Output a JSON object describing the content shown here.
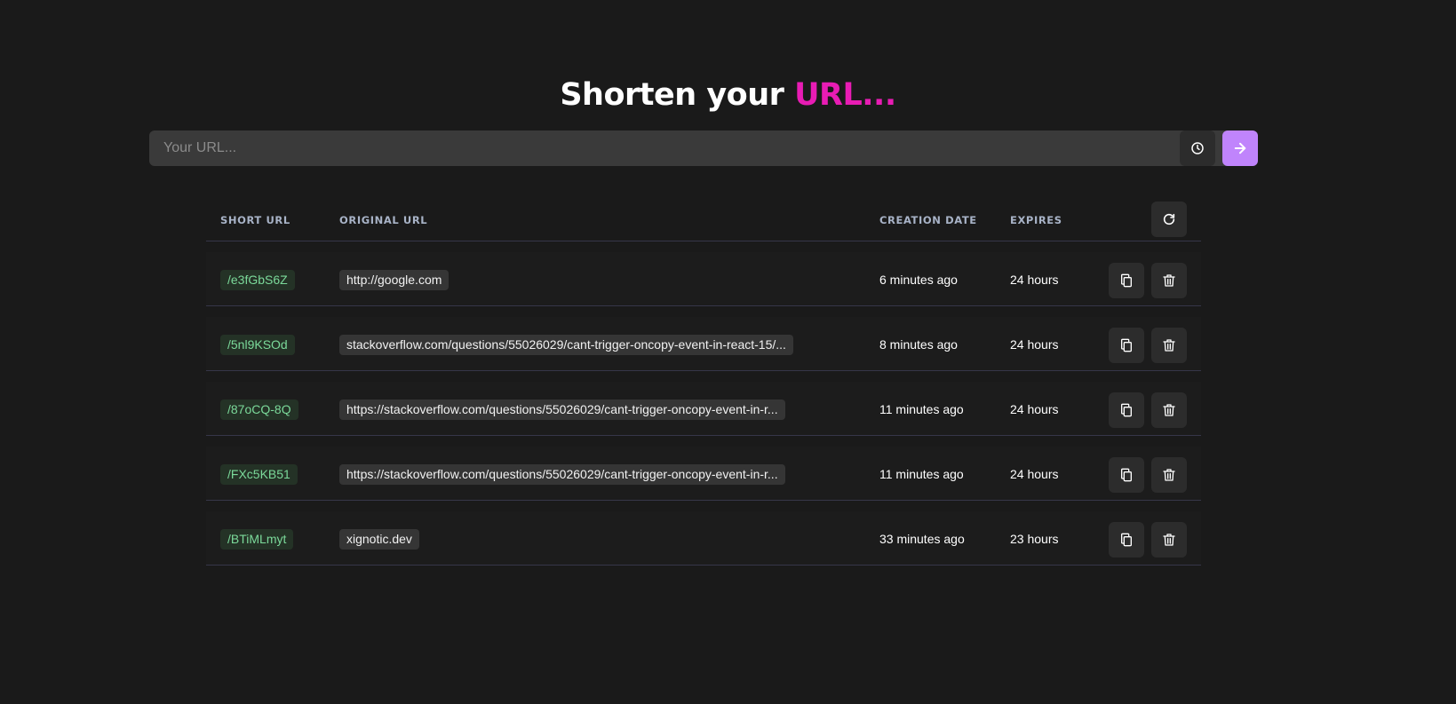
{
  "header": {
    "title_main": "Shorten your ",
    "title_accent": "URL..."
  },
  "url_input": {
    "placeholder": "Your URL...",
    "value": ""
  },
  "icons": {
    "history": "clock-icon",
    "submit": "arrow-right-icon",
    "refresh": "refresh-icon",
    "copy": "copy-icon",
    "delete": "trash-icon"
  },
  "colors": {
    "background": "#1a1a1a",
    "accent": "#e81cb4",
    "submit_button": "#c084fc",
    "short_url_text": "#7bd99a",
    "short_url_bg": "#243226"
  },
  "table": {
    "columns": [
      "SHORT URL",
      "ORIGINAL URL",
      "CREATION DATE",
      "EXPIRES"
    ],
    "rows": [
      {
        "short": "/e3fGbS6Z",
        "original": "http://google.com",
        "created": "6 minutes ago",
        "expires": "24 hours"
      },
      {
        "short": "/5nl9KSOd",
        "original": "stackoverflow.com/questions/55026029/cant-trigger-oncopy-event-in-react-15/...",
        "created": "8 minutes ago",
        "expires": "24 hours"
      },
      {
        "short": "/87oCQ-8Q",
        "original": "https://stackoverflow.com/questions/55026029/cant-trigger-oncopy-event-in-r...",
        "created": "11 minutes ago",
        "expires": "24 hours"
      },
      {
        "short": "/FXc5KB51",
        "original": "https://stackoverflow.com/questions/55026029/cant-trigger-oncopy-event-in-r...",
        "created": "11 minutes ago",
        "expires": "24 hours"
      },
      {
        "short": "/BTiMLmyt",
        "original": "xignotic.dev",
        "created": "33 minutes ago",
        "expires": "23 hours"
      }
    ]
  }
}
